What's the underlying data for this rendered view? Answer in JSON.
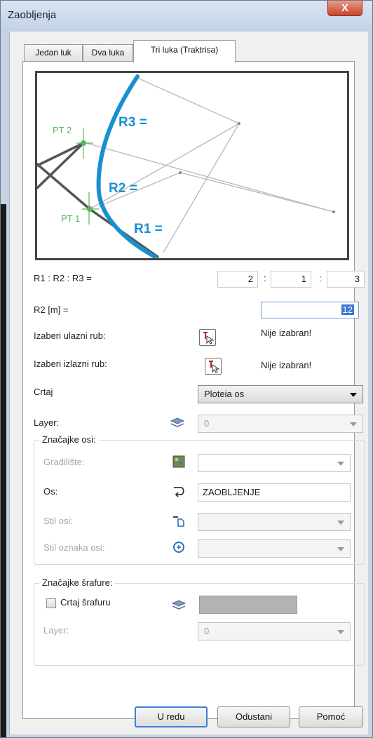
{
  "window": {
    "title": "Zaobljenja",
    "close_glyph": "X"
  },
  "tabs": [
    {
      "label": "Jedan luk",
      "active": false
    },
    {
      "label": "Dva luka",
      "active": false
    },
    {
      "label": "Tri luka (Traktrisa)",
      "active": true
    }
  ],
  "preview": {
    "labels": {
      "pt1": "PT 1",
      "pt2": "PT 2",
      "r1": "R1 =",
      "r2": "R2 =",
      "r3": "R3 ="
    },
    "colors": {
      "arc": "#1a8fd0",
      "tangent": "#555555",
      "guides": "#b8b8b8",
      "points": "#58b858"
    }
  },
  "ratio": {
    "label": "R1 : R2 : R3 =",
    "values": [
      "2",
      "1",
      "3"
    ],
    "separator": ":"
  },
  "r2": {
    "label": "R2 [m] =",
    "value": "12"
  },
  "entry_edge": {
    "label": "Izaberi ulazni rub:",
    "status": "Nije izabran!"
  },
  "exit_edge": {
    "label": "Izaberi izlazni rub:",
    "status": "Nije izabran!"
  },
  "draw": {
    "label": "Crtaj",
    "selected": "Ploteia os"
  },
  "layer": {
    "label": "Layer:",
    "selected": "0"
  },
  "axis_group": {
    "title": "Značajke osi:",
    "site": {
      "label": "Gradilište:",
      "value": ""
    },
    "axis": {
      "label": "Os:",
      "value": "ZAOBLJENJE"
    },
    "axis_style": {
      "label": "Stil osi:",
      "value": ""
    },
    "axis_label_style": {
      "label": "Stil oznaka osi:",
      "value": ""
    }
  },
  "hatch_group": {
    "title": "Značajke šrafure:",
    "checkbox_label": "Crtaj šrafuru",
    "checked": false,
    "layer": {
      "label": "Layer:",
      "selected": "0"
    }
  },
  "buttons": {
    "ok": "U redu",
    "cancel": "Odustani",
    "help": "Pomoć"
  }
}
